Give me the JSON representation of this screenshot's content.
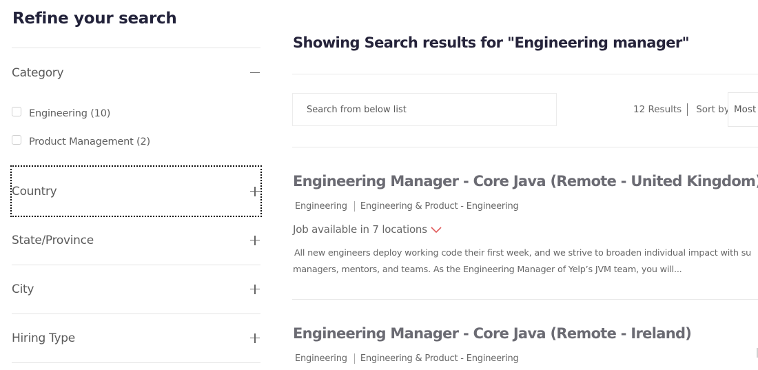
{
  "sidebar": {
    "title": "Refine your search",
    "facets": [
      {
        "label": "Category",
        "expanded": true,
        "toggle_icon": "minus-icon",
        "options": [
          {
            "label": "Engineering (10)",
            "checked": false
          },
          {
            "label": "Product Management (2)",
            "checked": false
          }
        ]
      },
      {
        "label": "Country",
        "expanded": false,
        "toggle_icon": "plus-icon",
        "focused": true
      },
      {
        "label": "State/Province",
        "expanded": false,
        "toggle_icon": "plus-icon"
      },
      {
        "label": "City",
        "expanded": false,
        "toggle_icon": "plus-icon"
      },
      {
        "label": "Hiring Type",
        "expanded": false,
        "toggle_icon": "plus-icon"
      }
    ]
  },
  "main": {
    "results_title": "Showing Search results for \"Engineering manager\"",
    "search": {
      "placeholder": "Search from below list",
      "value": ""
    },
    "results_count": "12 Results",
    "sort_label": "Sort by",
    "sort_value": "Most",
    "jobs": [
      {
        "title": "Engineering Manager - Core Java (Remote - United Kingdom)",
        "tags": [
          "Engineering",
          "Engineering & Product - Engineering"
        ],
        "locations": "Job available in 7 locations",
        "description": [
          "All new engineers deploy working code their first week, and we strive to broaden individual impact with su",
          "managers, mentors, and teams. As the Engineering Manager of Yelp’s JVM team, you will..."
        ]
      },
      {
        "title": "Engineering Manager - Core Java (Remote - Ireland)",
        "tags": [
          "Engineering",
          "Engineering & Product - Engineering"
        ]
      }
    ]
  },
  "colors": {
    "heading": "#25233a",
    "job_title": "#6b6b73",
    "accent_chevron": "#e05a5a",
    "divider": "#e4e4e4"
  }
}
